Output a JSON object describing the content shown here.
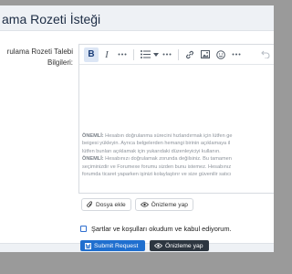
{
  "modal": {
    "title": "ama Rozeti İsteği"
  },
  "form": {
    "label_line1": "rulama Rozeti Talebi",
    "label_line2": "Bilgileri:"
  },
  "editor": {
    "toolbar": [
      "bold-icon",
      "italic-icon",
      "more-options-icon",
      "list-icon",
      "list-dropdown-icon",
      "more-options-icon",
      "link-icon",
      "image-icon",
      "emoji-icon",
      "more-options-icon",
      "undo-icon"
    ],
    "note": {
      "line1_bold": "ÖNEMLİ:",
      "line1": " Hesabın doğrulanma sürecini hızlandırmak için lütfen ge",
      "line2": "beigesi yükleyin. Ayrıca belgelerden hemangi birinin açıklamaya il",
      "line3": "lütfen bunları açıklamak için yukarıdaki düzenleyiciyi kullanın.",
      "line4_bold": "ÖNEMLİ:",
      "line4": " Hesabınızı doğrulamak zorunda değilsiniz. Bu tamamen",
      "line5": "seçiminizdir ve Forumexe forumu sizden bunu istemez. Hesabınız",
      "line6": "forumda ticaret yaparken işinizi kolaylaştırır ve size güvenilir satıcı"
    },
    "attach_label": "Dosya ekle",
    "preview_label": "Önizleme yap"
  },
  "terms": {
    "label": "Şartlar ve koşulları okudum ve kabul ediyorum."
  },
  "footer": {
    "submit_label": "Submit Request",
    "preview_label": "Önizleme yap"
  },
  "colors": {
    "primary": "#1f6fcf",
    "dark": "#2d3640",
    "header_bg": "#eef1f5"
  }
}
